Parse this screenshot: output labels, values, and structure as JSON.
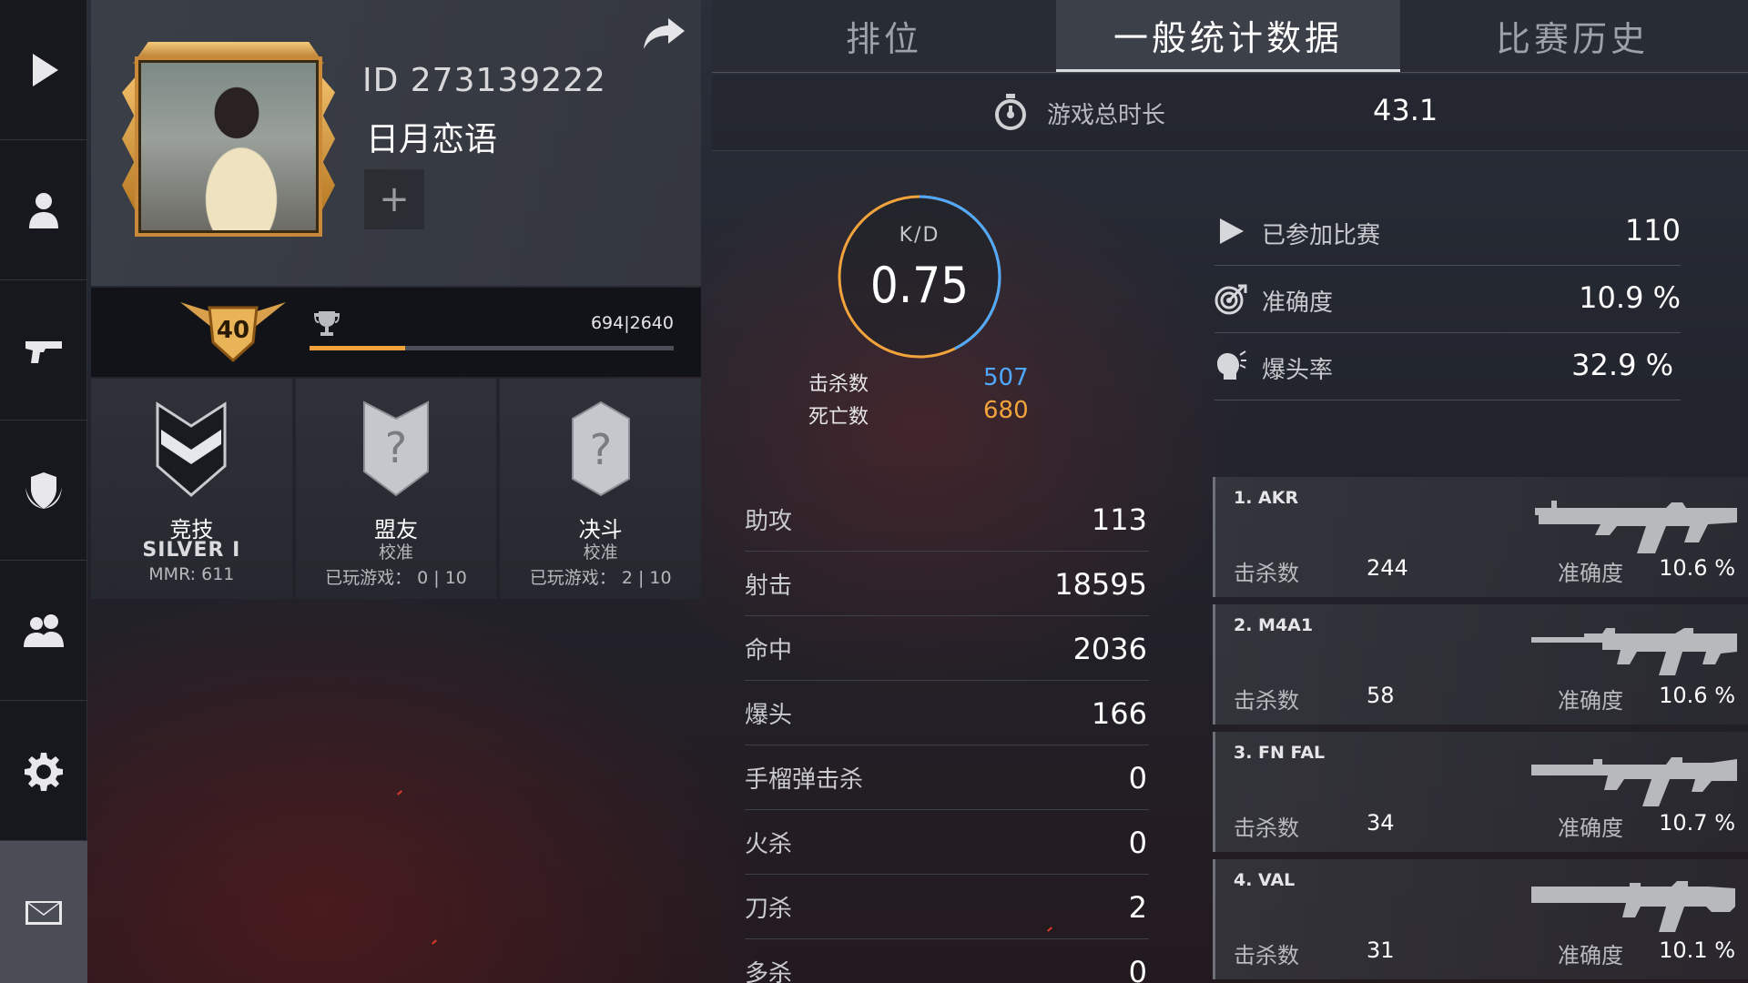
{
  "sidebar": {
    "items": [
      {
        "icon": "play-icon"
      },
      {
        "icon": "profile-icon"
      },
      {
        "icon": "pistol-icon"
      },
      {
        "icon": "clan-shield-icon"
      },
      {
        "icon": "friends-icon"
      },
      {
        "icon": "gear-icon"
      },
      {
        "icon": "mail-icon"
      }
    ]
  },
  "profile": {
    "id_text": "ID 273139222",
    "name": "日月恋语",
    "add_label": "+",
    "level": "40",
    "xp_text": "694|2640",
    "xp_progress": 0.263
  },
  "modes": [
    {
      "title": "竞技",
      "rank": "SILVER I",
      "footer": "MMR: 611"
    },
    {
      "title": "盟友",
      "sub": "校准",
      "footer": "已玩游戏： 0 | 10"
    },
    {
      "title": "决斗",
      "sub": "校准",
      "footer": "已玩游戏： 2 | 10"
    }
  ],
  "tabs": [
    "排位",
    "一般统计数据",
    "比赛历史"
  ],
  "playtime": {
    "label": "游戏总时长",
    "value": "43.1"
  },
  "kd": {
    "label": "K/D",
    "value": "0.75",
    "kills_label": "击杀数",
    "kills": "507",
    "deaths_label": "死亡数",
    "deaths": "680",
    "colors": {
      "kills": "#4fa9ff",
      "deaths": "#f3a33c"
    }
  },
  "summary": [
    {
      "icon": "play-icon",
      "label": "已参加比赛",
      "value": "110"
    },
    {
      "icon": "target-icon",
      "label": "准确度",
      "value": "10.9 %"
    },
    {
      "icon": "headshot-icon",
      "label": "爆头率",
      "value": "32.9 %"
    }
  ],
  "stats": [
    {
      "label": "助攻",
      "value": "113"
    },
    {
      "label": "射击",
      "value": "18595"
    },
    {
      "label": "命中",
      "value": "2036"
    },
    {
      "label": "爆头",
      "value": "166"
    },
    {
      "label": "手榴弹击杀",
      "value": "0"
    },
    {
      "label": "火杀",
      "value": "0"
    },
    {
      "label": "刀杀",
      "value": "2"
    },
    {
      "label": "多杀",
      "value": "0"
    }
  ],
  "weapons": [
    {
      "name": "1. AKR",
      "kills_label": "击杀数",
      "kills": "244",
      "acc_label": "准确度",
      "accuracy": "10.6 %"
    },
    {
      "name": "2. M4A1",
      "kills_label": "击杀数",
      "kills": "58",
      "acc_label": "准确度",
      "accuracy": "10.6 %"
    },
    {
      "name": "3. FN FAL",
      "kills_label": "击杀数",
      "kills": "34",
      "acc_label": "准确度",
      "accuracy": "10.7 %"
    },
    {
      "name": "4. VAL",
      "kills_label": "击杀数",
      "kills": "31",
      "acc_label": "准确度",
      "accuracy": "10.1 %"
    }
  ]
}
